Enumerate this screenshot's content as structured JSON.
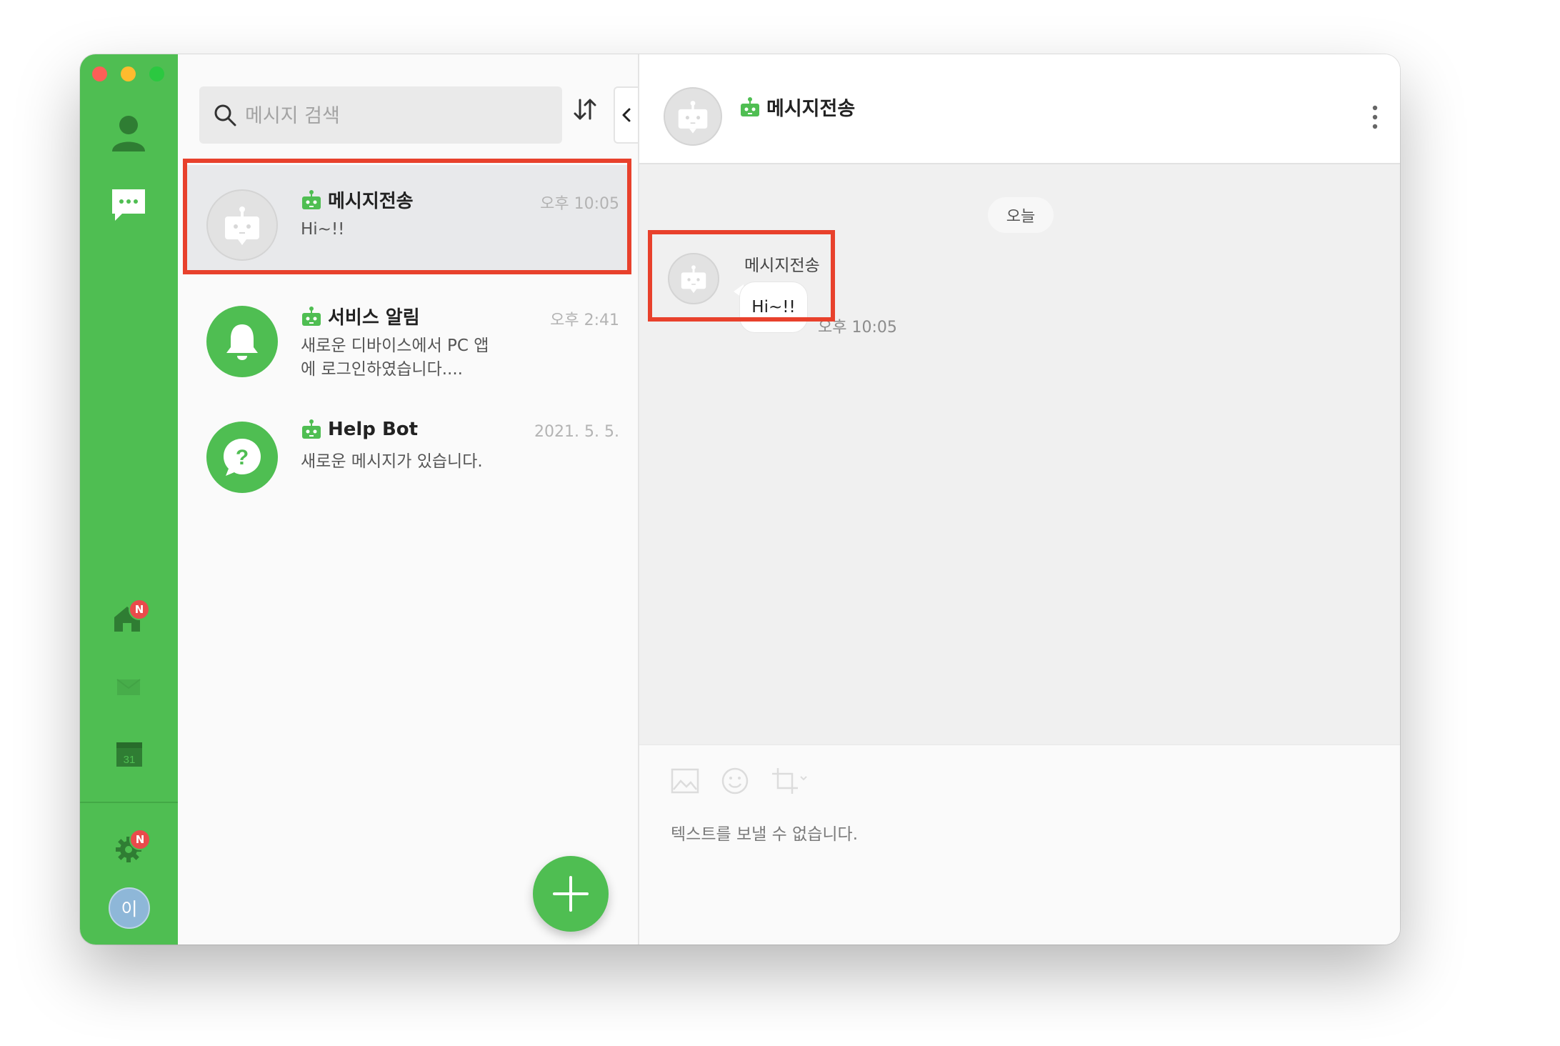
{
  "sidebar": {
    "badge_home": "N",
    "badge_settings": "N",
    "avatar_initial": "이",
    "calendar_day": "31",
    "icons": [
      "person-icon",
      "chat-icon",
      "home-icon",
      "mail-icon",
      "calendar-icon",
      "gear-icon"
    ]
  },
  "list": {
    "search_placeholder": "메시지 검색",
    "conversations": [
      {
        "name": "메시지전송",
        "time": "오후 10:05",
        "preview": "Hi~!!",
        "icon": "robot-avatar-icon",
        "selected": true
      },
      {
        "name": "서비스 알림",
        "time": "오후 2:41",
        "preview": "새로운 디바이스에서 PC 앱에 로그인하였습니다....",
        "icon": "bell-icon"
      },
      {
        "name": "Help Bot",
        "time": "2021. 5. 5.",
        "preview": "새로운 메시지가 있습니다.",
        "icon": "question-icon"
      }
    ]
  },
  "chat": {
    "title": "메시지전송",
    "date_divider": "오늘",
    "message": {
      "sender": "메시지전송",
      "text": "Hi~!!",
      "time": "오후 10:05"
    },
    "composer_disabled_text": "텍스트를 보낼 수 없습니다."
  },
  "colors": {
    "brand_green": "#4fbe52",
    "highlight_red": "#e8412c"
  }
}
